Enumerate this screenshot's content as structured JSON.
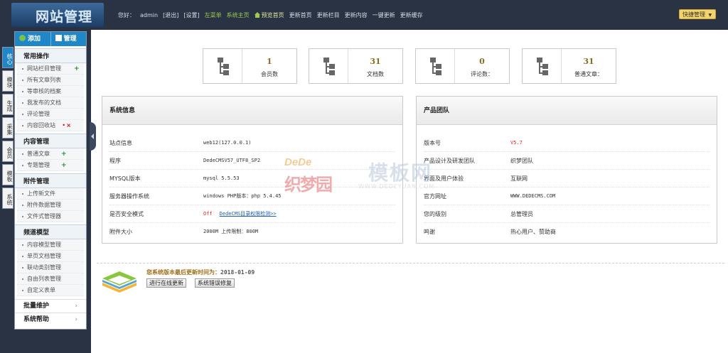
{
  "header": {
    "logo_text": "网站管理",
    "nav": [
      "您好：",
      "admin",
      "[退出]",
      "[设置]",
      "左菜单",
      "系统主页",
      "预览首页",
      "更新首页",
      "更新栏目",
      "更新内容",
      "一键更新",
      "更新缓存"
    ],
    "quick_menu": "快捷管理"
  },
  "side": {
    "head_add": "添加",
    "head_manage": "管理",
    "vertical_tabs": [
      "核心",
      "模块",
      "生成",
      "采集",
      "会员",
      "模板",
      "系统"
    ],
    "groups": [
      {
        "title": "常用操作",
        "items": [
          "网站栏目管理",
          "所有文章列表",
          "等审核的档案",
          "我发布的文档",
          "评论管理",
          "内容回收站"
        ]
      },
      {
        "title": "内容管理",
        "items": [
          "普通文章",
          "专题管理"
        ]
      },
      {
        "title": "附件管理",
        "items": [
          "上传新文件",
          "附件数据管理",
          "文件式管理器"
        ]
      },
      {
        "title": "频道模型",
        "items": [
          "内容模型管理",
          "单页文档管理",
          "联动类别管理",
          "自由列表管理",
          "自定义表单"
        ]
      }
    ],
    "bottom_links": [
      "批量维护",
      "系统帮助"
    ]
  },
  "stats": [
    {
      "value": "1",
      "label": "会员数"
    },
    {
      "value": "31",
      "label": "文档数"
    },
    {
      "value": "0",
      "label": "评论数："
    },
    {
      "value": "31",
      "label": "普通文章："
    }
  ],
  "system_info": {
    "title": "系统信息",
    "rows": [
      {
        "key": "站点信息",
        "value": "web12(127.0.0.1)"
      },
      {
        "key": "程序",
        "value": "DedeCMSV57_UTF8_SP2"
      },
      {
        "key": "MYSQL版本",
        "value": "mysql 5.5.53"
      },
      {
        "key": "服务器操作系统",
        "value": "windows PHP版本：php 5.4.45"
      },
      {
        "key": "是否安全模式",
        "value": "Off",
        "link": "DedeCMS目录权限检测>>"
      },
      {
        "key": "附件大小",
        "value": "2000M 上传限制：800M"
      }
    ]
  },
  "team_info": {
    "title": "产品团队",
    "rows": [
      {
        "key": "版本号",
        "value": "V5.7"
      },
      {
        "key": "产品设计及研发团队",
        "value": "织梦团队"
      },
      {
        "key": "界面及用户体验",
        "value": "互联网"
      },
      {
        "key": "官方网址",
        "value": "WWW.DEDECMS.COM"
      },
      {
        "key": "您的级别",
        "value": "总管理员"
      },
      {
        "key": "鸣谢",
        "value": "热心用户、赞助商"
      }
    ]
  },
  "update": {
    "label": "您系统版本最后更新时间为：",
    "date": "2018-01-09",
    "online_update": "进行在线更新",
    "repair": "系统错误修复"
  },
  "watermark": {
    "dede": "DeDe",
    "cn1": "织梦园",
    "cn2": "模板网",
    "url": "WWW.DEDEYUAN.COM"
  }
}
